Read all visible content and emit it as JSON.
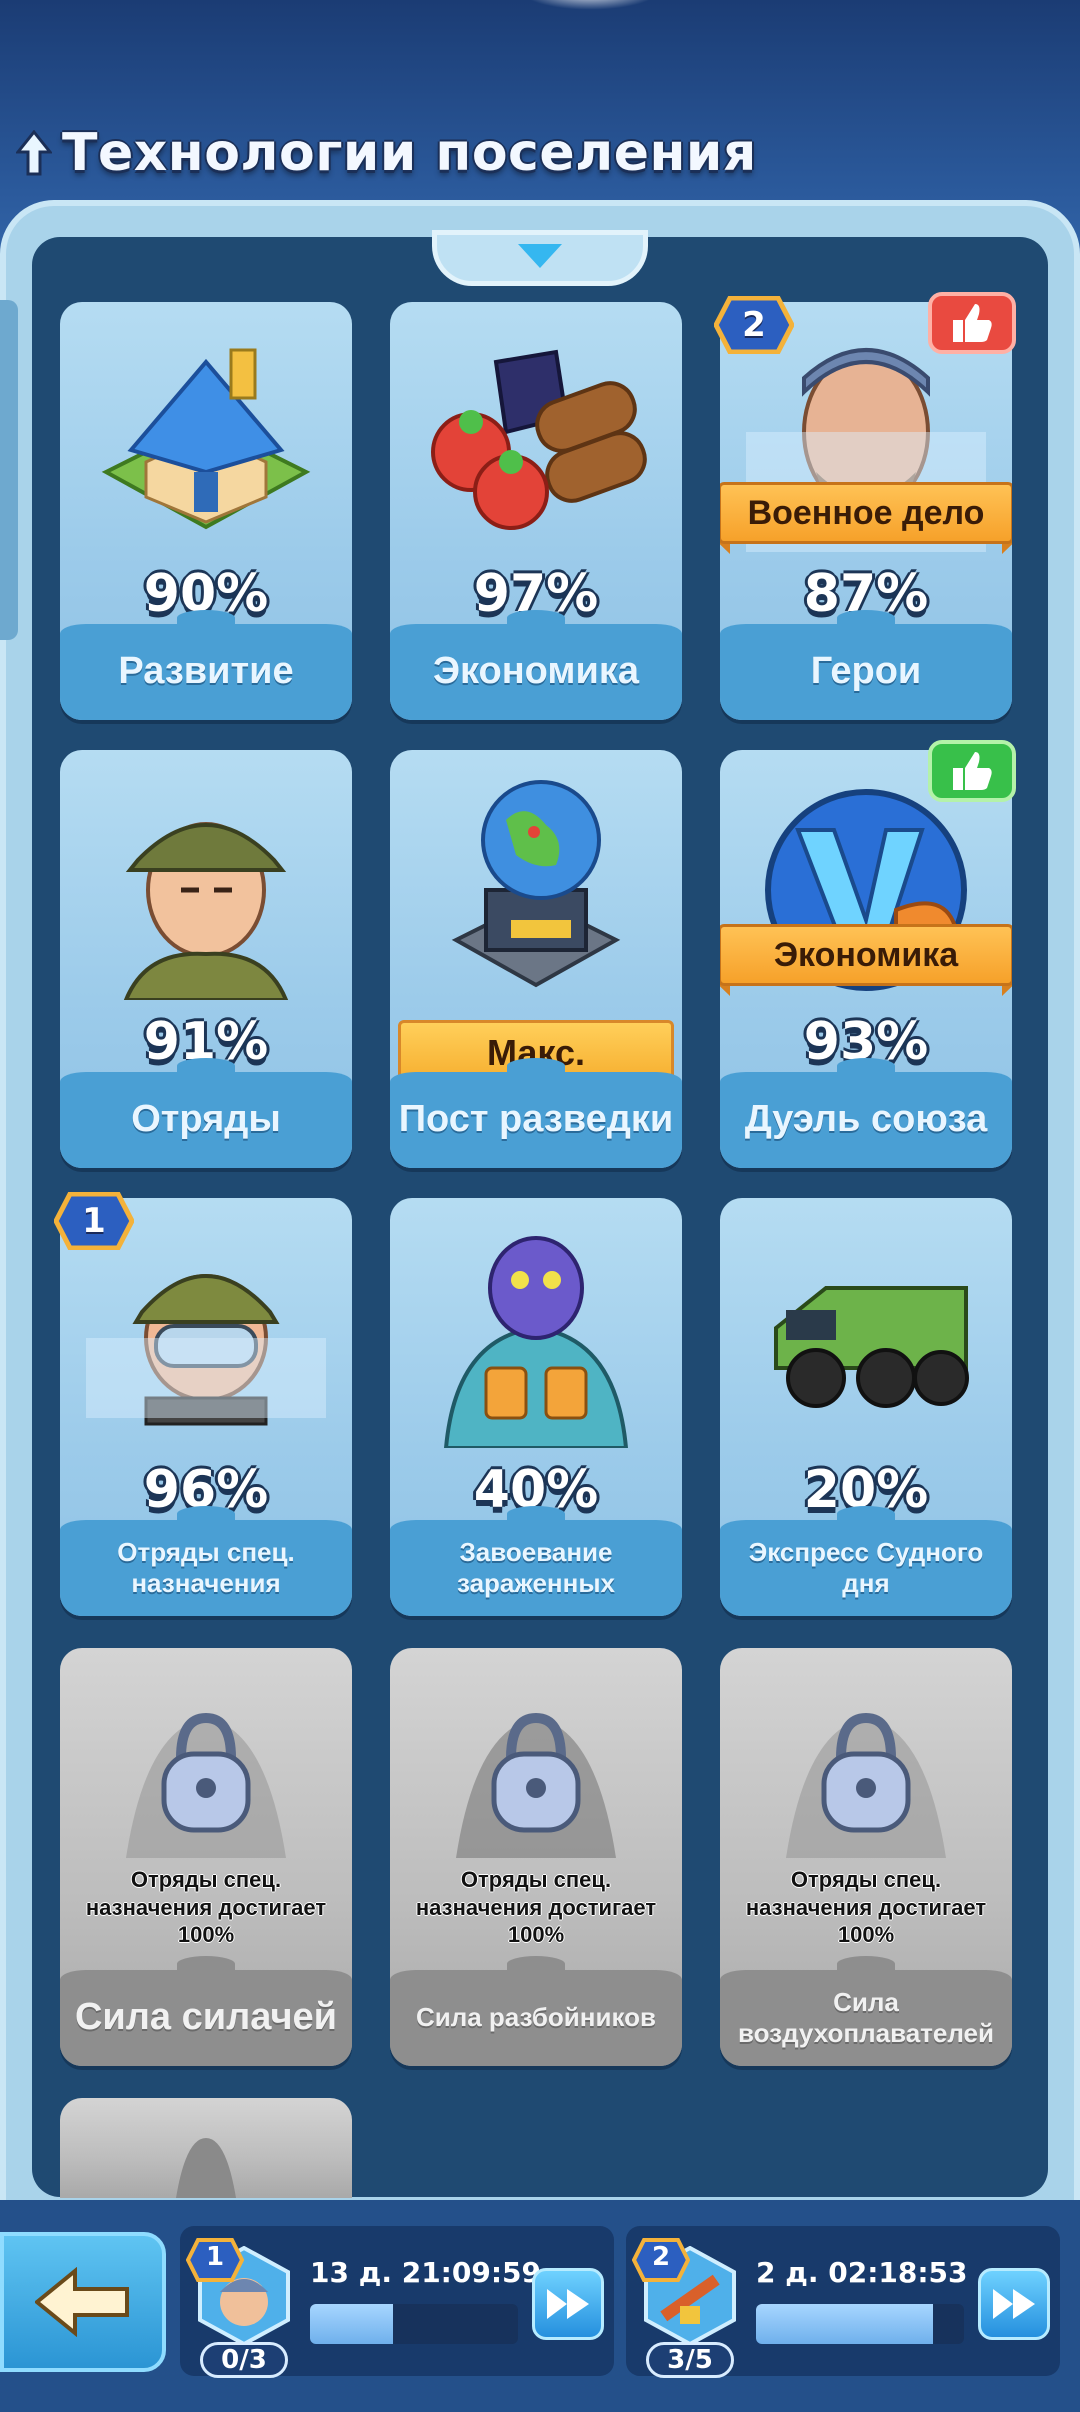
{
  "header": {
    "title": "Технологии поселения",
    "icon": "upgrade-arrow-icon"
  },
  "cards": [
    {
      "id": "development",
      "label": "Развитие",
      "percent": "90%",
      "art": "house-icon"
    },
    {
      "id": "economy",
      "label": "Экономика",
      "percent": "97%",
      "art": "resources-icon"
    },
    {
      "id": "heroes",
      "label": "Герои",
      "percent": "87%",
      "art": "hero-portrait-icon",
      "badge": "2",
      "ribbon": "Военное дело",
      "thumb": "red"
    },
    {
      "id": "squads",
      "label": "Отряды",
      "percent": "91%",
      "art": "soldier-icon"
    },
    {
      "id": "recon",
      "label": "Пост разведки",
      "percent": "Макс.",
      "art": "radar-globe-icon"
    },
    {
      "id": "alliance-duel",
      "label": "Дуэль союза",
      "percent": "93%",
      "art": "versus-icon",
      "ribbon": "Экономика",
      "thumb": "green"
    },
    {
      "id": "special-squads",
      "label": "Отряды спец. назначения",
      "percent": "96%",
      "art": "special-soldier-icon",
      "badge": "1"
    },
    {
      "id": "infected",
      "label": "Завоевание зараженных",
      "percent": "40%",
      "art": "zombie-icon"
    },
    {
      "id": "doomsday",
      "label": "Экспресс Судного дня",
      "percent": "20%",
      "art": "armored-truck-icon"
    },
    {
      "id": "strongmen",
      "label": "Сила силачей",
      "locked_text": "Отряды спец. назначения достигает 100%",
      "art": "lock-icon"
    },
    {
      "id": "bandits",
      "label": "Сила разбойников",
      "locked_text": "Отряды спец. назначения достигает 100%",
      "art": "lock-icon"
    },
    {
      "id": "aeronauts",
      "label": "Сила воздухоплавателей",
      "locked_text": "Отряды спец. назначения достигает 100%",
      "art": "lock-icon"
    }
  ],
  "queues": [
    {
      "badge": "1",
      "count": "0/3",
      "timer": "13 д. 21:09:59",
      "progress": 0.4,
      "avatar": "researcher-icon"
    },
    {
      "badge": "2",
      "count": "3/5",
      "timer": "2 д. 02:18:53",
      "progress": 0.85,
      "avatar": "rifle-icon"
    }
  ],
  "colors": {
    "frame": "#a9d3ea",
    "panel": "#1f4a72",
    "card": "#9ccbea",
    "ribbon": "#f6a12a",
    "thumb_red": "#e94a40",
    "thumb_green": "#38c04a"
  }
}
